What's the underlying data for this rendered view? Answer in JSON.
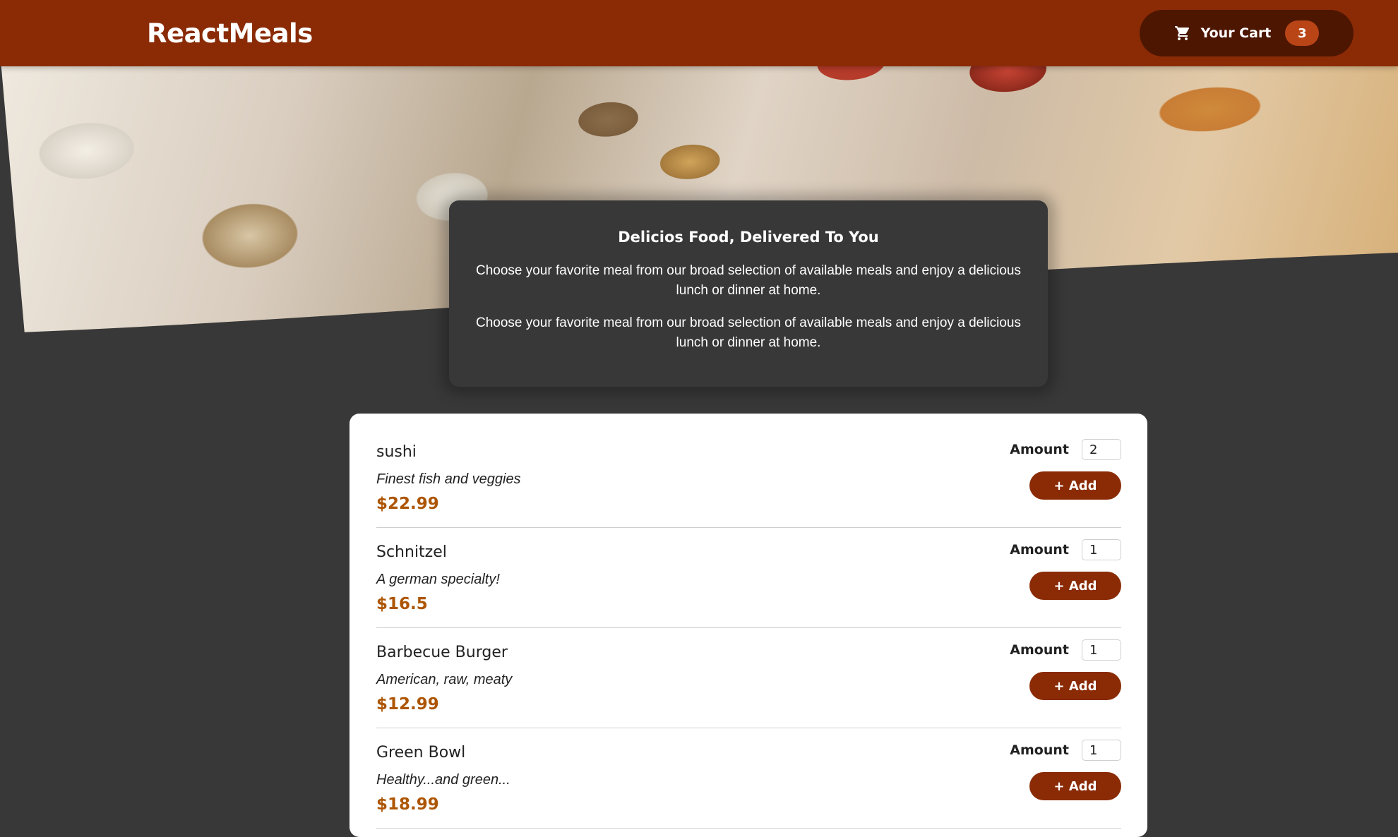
{
  "header": {
    "logo": "ReactMeals",
    "cart_label": "Your Cart",
    "cart_count": "3"
  },
  "summary": {
    "title": "Delicios Food, Delivered To You",
    "paragraphs": [
      "Choose your favorite meal from our broad selection of available meals and enjoy a delicious lunch or dinner at home.",
      "Choose your favorite meal from our broad selection of available meals and enjoy a delicious lunch or dinner at home."
    ]
  },
  "meals": {
    "amount_label": "Amount",
    "add_label": "+ Add",
    "items": [
      {
        "name": "sushi",
        "description": "Finest fish and veggies",
        "price": "$22.99",
        "amount": "2"
      },
      {
        "name": "Schnitzel",
        "description": "A german specialty!",
        "price": "$16.5",
        "amount": "1"
      },
      {
        "name": "Barbecue Burger",
        "description": "American, raw, meaty",
        "price": "$12.99",
        "amount": "1"
      },
      {
        "name": "Green Bowl",
        "description": "Healthy...and green...",
        "price": "$18.99",
        "amount": "1"
      }
    ]
  },
  "colors": {
    "header_bg": "#8a2b06",
    "cart_button_bg": "#4d1601",
    "cart_badge_bg": "#b94517",
    "page_bg": "#383838",
    "price": "#ad5502"
  },
  "icons": {
    "cart": "shopping-cart-icon"
  }
}
